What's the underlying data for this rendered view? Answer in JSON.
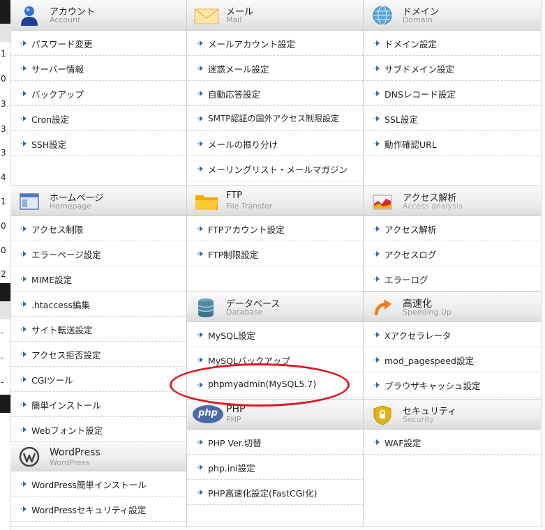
{
  "strip": {
    "numbers": [
      "1",
      "0",
      "3",
      "3",
      "3",
      "4",
      "1",
      "0",
      "0",
      "2",
      "-",
      "-",
      "-"
    ]
  },
  "sections": {
    "account": {
      "title": "アカウント",
      "subtitle": "Account",
      "icon": "person-icon",
      "items": [
        "パスワード変更",
        "サーバー情報",
        "バックアップ",
        "Cron設定",
        "SSH設定"
      ]
    },
    "homepage": {
      "title": "ホームページ",
      "subtitle": "Homepage",
      "icon": "window-icon",
      "items": [
        "アクセス制限",
        "エラーページ設定",
        "MIME設定",
        ".htaccess編集",
        "サイト転送設定",
        "アクセス拒否設定",
        "CGIツール",
        "簡単インストール",
        "Webフォント設定"
      ]
    },
    "wordpress": {
      "title": "WordPress",
      "subtitle": "WordPress",
      "icon": "wordpress-icon",
      "items": [
        "WordPress簡単インストール",
        "WordPressセキュリティ設定"
      ]
    },
    "mail": {
      "title": "メール",
      "subtitle": "Mail",
      "icon": "envelope-icon",
      "items": [
        "メールアカウント設定",
        "迷惑メール設定",
        "自動応答設定",
        "SMTP認証の国外アクセス制限設定",
        "メールの振り分け",
        "メーリングリスト・メールマガジン"
      ]
    },
    "ftp": {
      "title": "FTP",
      "subtitle": "File Transfer",
      "icon": "folder-icon",
      "items": [
        "FTPアカウント設定",
        "FTP制限設定"
      ]
    },
    "database": {
      "title": "データベース",
      "subtitle": "Database",
      "icon": "database-icon",
      "items": [
        "MySQL設定",
        "MySQLバックアップ",
        "phpmyadmin(MySQL5.7)"
      ]
    },
    "php": {
      "title": "PHP",
      "subtitle": "PHP",
      "icon": "php-icon",
      "badge": "php",
      "items": [
        "PHP Ver.切替",
        "php.ini設定",
        "PHP高速化設定(FastCGI化)"
      ]
    },
    "domain": {
      "title": "ドメイン",
      "subtitle": "Domain",
      "icon": "globe-icon",
      "items": [
        "ドメイン設定",
        "サブドメイン設定",
        "DNSレコード設定",
        "SSL設定",
        "動作確認URL"
      ]
    },
    "analysis": {
      "title": "アクセス解析",
      "subtitle": "Access analysis",
      "icon": "chart-icon",
      "items": [
        "アクセス解析",
        "アクセスログ",
        "エラーログ"
      ]
    },
    "speed": {
      "title": "高速化",
      "subtitle": "Speeding Up",
      "icon": "speed-arrow-icon",
      "items": [
        "Xアクセラレータ",
        "mod_pagespeed設定",
        "ブラウザキャッシュ設定"
      ]
    },
    "security": {
      "title": "セキュリティ",
      "subtitle": "Security",
      "icon": "shield-icon",
      "items": [
        "WAF設定"
      ]
    }
  },
  "colors": {
    "highlight_oval": "#e0141e",
    "arrow": "#2a6db5"
  }
}
